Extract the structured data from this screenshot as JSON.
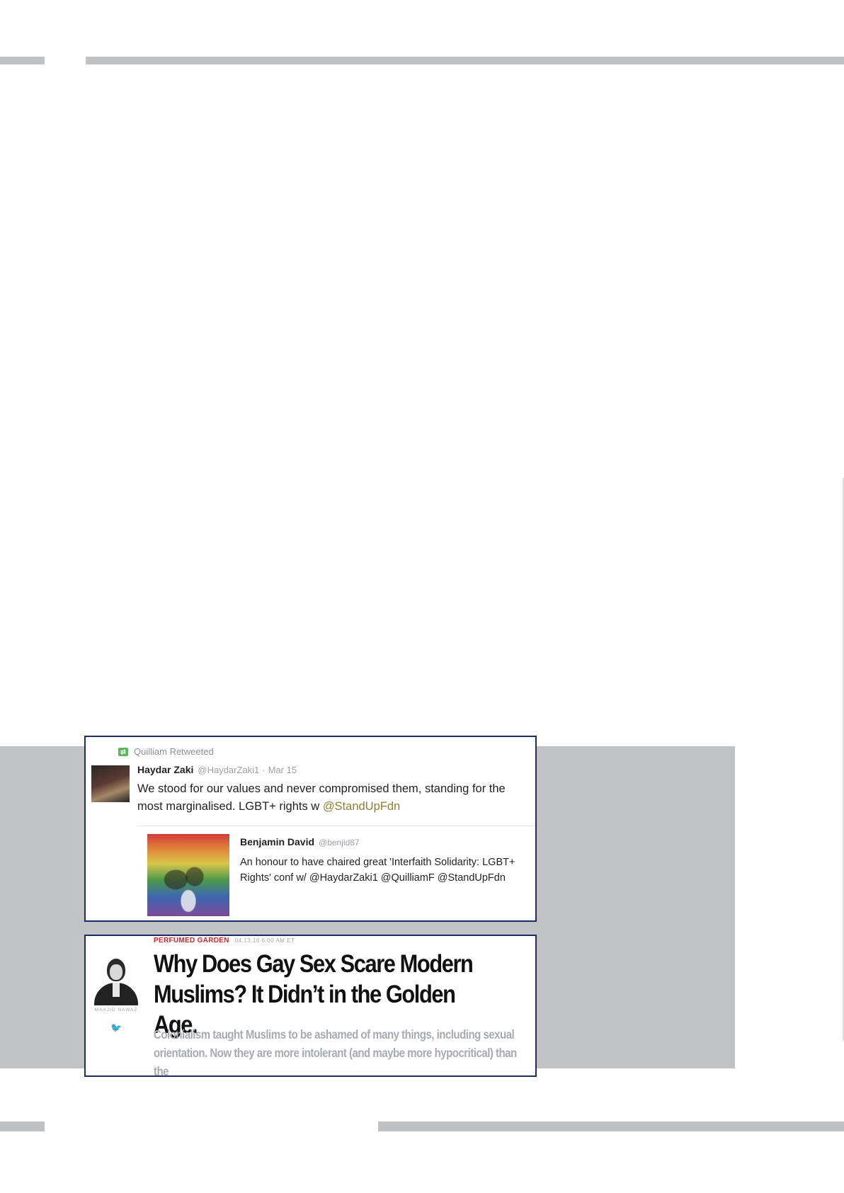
{
  "tweet": {
    "retweet_label": "Quilliam Retweeted",
    "author_name": "Haydar Zaki",
    "author_handle": "@HaydarZaki1",
    "date": "Mar 15",
    "text": "We stood for our values and never compromised them, standing for the most marginalised. LGBT+ rights w ",
    "mention": "@StandUpFdn",
    "quote": {
      "author_name": "Benjamin David",
      "author_handle": "@benjid87",
      "text": "An honour to have chaired great 'Interfaith Solidarity: LGBT+ Rights' conf w/ @HaydarZaki1 @QuilliamF @StandUpFdn"
    }
  },
  "article": {
    "category": "PERFUMED GARDEN",
    "date": "04.13.16 6:00 AM ET",
    "author_name": "MAAJID NAWAZ",
    "headline": "Why Does Gay Sex Scare Modern Muslims? It Didn’t in the Golden Age.",
    "dek": "Colonialism taught Muslims to be ashamed of many things, including sexual orientation. Now they are more intolerant (and maybe more hypocritical) than the"
  },
  "colors": {
    "frame_border": "#1f2a6b",
    "rule_gray": "#c0c1c3",
    "panel_gray": "#c1c2c4",
    "category_red": "#d81f26",
    "mention_olive": "#8c7f2f",
    "twitter_blue": "#2f7fcf"
  }
}
